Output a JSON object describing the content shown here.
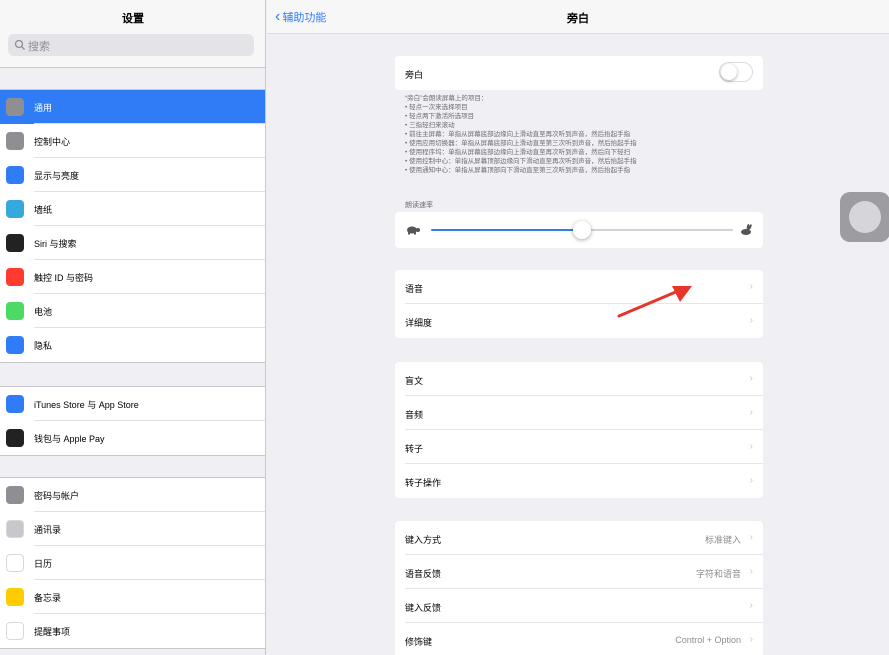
{
  "sidebar": {
    "title": "设置",
    "search_placeholder": "搜索",
    "groups": [
      [
        {
          "label": "通用",
          "icon": "gear-icon",
          "color": "#8e8e93",
          "selected": true
        },
        {
          "label": "控制中心",
          "icon": "control-center-icon",
          "color": "#8e8e93"
        },
        {
          "label": "显示与亮度",
          "icon": "display-icon",
          "color": "#2f7cf6"
        },
        {
          "label": "墙纸",
          "icon": "wallpaper-icon",
          "color": "#34aadc"
        },
        {
          "label": "Siri 与搜索",
          "icon": "siri-icon",
          "color": "#222222"
        },
        {
          "label": "触控 ID 与密码",
          "icon": "fingerprint-icon",
          "color": "#ff3b30"
        },
        {
          "label": "电池",
          "icon": "battery-icon",
          "color": "#4cd964"
        },
        {
          "label": "隐私",
          "icon": "hand-icon",
          "color": "#2f7cf6"
        }
      ],
      [
        {
          "label": "iTunes Store 与 App Store",
          "icon": "app-store-icon",
          "color": "#2f7cf6"
        },
        {
          "label": "钱包与 Apple Pay",
          "icon": "wallet-icon",
          "color": "#222222"
        }
      ],
      [
        {
          "label": "密码与帐户",
          "icon": "key-icon",
          "color": "#8e8e93"
        },
        {
          "label": "通讯录",
          "icon": "contacts-icon",
          "color": "#c8c7cc"
        },
        {
          "label": "日历",
          "icon": "calendar-icon",
          "color": "#ffffff"
        },
        {
          "label": "备忘录",
          "icon": "notes-icon",
          "color": "#ffcc00"
        },
        {
          "label": "提醒事项",
          "icon": "reminders-icon",
          "color": "#ffffff"
        }
      ]
    ]
  },
  "nav": {
    "back_label": "辅助功能",
    "title": "旁白"
  },
  "voiceover": {
    "label": "旁白",
    "enabled": false,
    "description": [
      "“旁白”会朗读屏幕上的项目：",
      "• 轻点一次来选择项目",
      "• 轻点两下激活所选项目",
      "• 三指轻扫来滚动",
      "• 前往主屏幕：单指从屏幕底部边缘向上滑动直至再次听到声音，然后抬起手指",
      "• 使用应用切换器：单指从屏幕底部向上滑动直至第三次听到声音，然后抬起手指",
      "• 使用程序坞：单指从屏幕底部边缘向上滑动直至再次听到声音，然后向下轻扫",
      "• 使用控制中心：单指从屏幕顶部边缘向下滑动直至再次听到声音，然后抬起手指",
      "• 使用通知中心：单指从屏幕顶部向下滑动直至第三次听到声音，然后抬起手指"
    ]
  },
  "speaking_rate": {
    "label": "朗读速率",
    "value": 0.5
  },
  "section2": [
    "语音",
    "详细度"
  ],
  "section3": [
    "盲文",
    "音频",
    "转子",
    "转子操作"
  ],
  "section4": [
    {
      "label": "键入方式",
      "value": "标准键入"
    },
    {
      "label": "语音反馈",
      "value": "字符和语音"
    },
    {
      "label": "键入反馈",
      "value": ""
    },
    {
      "label": "修饰键",
      "value": "Control + Option"
    }
  ],
  "colors": {
    "accent": "#2f7cf6",
    "annotation_arrow": "#e8342b"
  }
}
